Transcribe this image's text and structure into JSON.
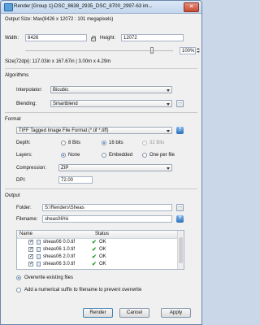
{
  "window": {
    "title": "Render [Group 1]-DSC_8638_2935_DSC_8700_2997-63 im..."
  },
  "output_size": {
    "header": "Output Size: Max(8426 x 12072 : 101 megapixels)",
    "width_label": "Width:",
    "width_value": "8426",
    "height_label": "Height:",
    "height_value": "12072",
    "scale_value": "100%",
    "size_readout": "Size(72dpi): 117.03in x 167.67in | 3.00m x 4.29m"
  },
  "algorithms": {
    "label": "Algorithms",
    "interpolator_label": "Interpolator:",
    "interpolator_value": "Bicubic",
    "blending_label": "Blending:",
    "blending_value": "Smartblend",
    "more_label": "..."
  },
  "format": {
    "label": "Format",
    "format_value": "TIFF Tagged Image File Format (*.tif *.tiff)",
    "help_label": "?",
    "depth_label": "Depth:",
    "depth_options": [
      "8 Bits",
      "16 bits",
      "32 Bits"
    ],
    "depth_selected": "16 bits",
    "layers_label": "Layers:",
    "layers_options": [
      "None",
      "Embedded",
      "One per file"
    ],
    "layers_selected": "None",
    "compression_label": "Compression:",
    "compression_value": "ZIP",
    "dpi_label": "DPI:",
    "dpi_value": "72.00"
  },
  "output": {
    "label": "Output",
    "folder_label": "Folder:",
    "folder_value": "S:\\Renders\\Sheas",
    "filename_label": "Filename:",
    "filename_value": "sheas06%i",
    "table_headers": [
      "Name",
      "Status"
    ],
    "rows": [
      {
        "name": "sheas06 0.0.tif",
        "status": "OK"
      },
      {
        "name": "sheas06 1.0.tif",
        "status": "OK"
      },
      {
        "name": "sheas06 2.0.tif",
        "status": "OK"
      },
      {
        "name": "sheas06 3.0.tif",
        "status": "OK"
      }
    ],
    "overwrite_option": "Overwrite existing files",
    "suffix_option": "Add a numerical suffix to filename to prevent overwrite",
    "selected_option": "overwrite"
  },
  "buttons": {
    "render": "Render",
    "cancel": "Cancel",
    "apply": "Apply"
  },
  "colors": {
    "accent": "#1f6fc0",
    "ok": "#2a9a2a",
    "title_bar": "#c3d6ec"
  }
}
